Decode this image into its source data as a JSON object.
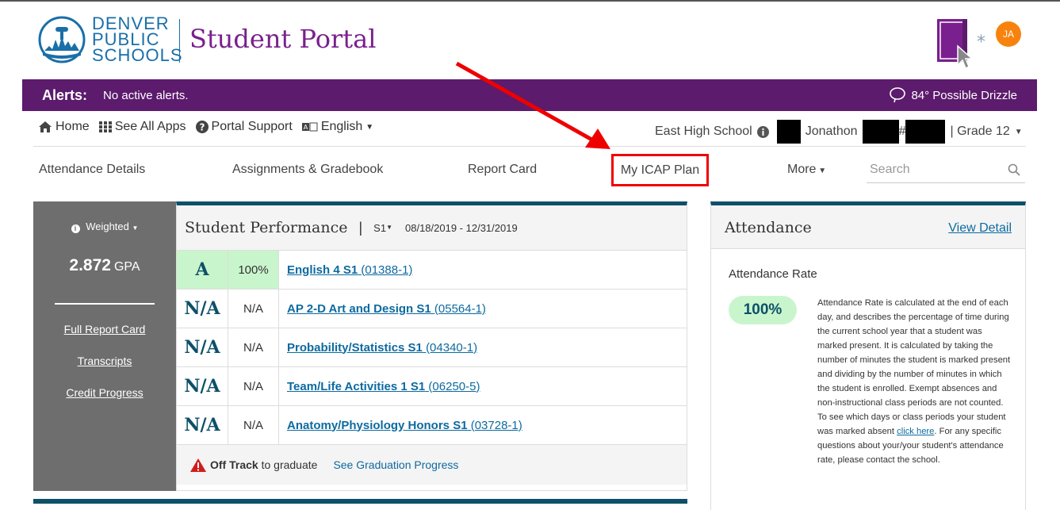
{
  "header": {
    "logo_lines": [
      "DENVER",
      "PUBLIC",
      "SCHOOLS"
    ],
    "portal_title": "Student Portal",
    "avatar_initials": "JA"
  },
  "alerts": {
    "label": "Alerts:",
    "message": "No active alerts.",
    "weather": "84° Possible Drizzle"
  },
  "util_nav": {
    "home": "Home",
    "apps": "See All Apps",
    "support": "Portal Support",
    "language": "English"
  },
  "student": {
    "school": "East High School",
    "name_part": "Jonathon",
    "id_prefix": "#",
    "grade": "| Grade 12"
  },
  "main_nav": {
    "attendance": "Attendance Details",
    "assignments": "Assignments & Gradebook",
    "report_card": "Report Card",
    "icap": "My ICAP Plan",
    "more": "More",
    "search_placeholder": "Search"
  },
  "gpa": {
    "mode": "Weighted",
    "value": "2.872",
    "unit": "GPA",
    "links": [
      "Full Report Card",
      "Transcripts",
      "Credit Progress"
    ]
  },
  "performance": {
    "title": "Student Performance",
    "separator": "|",
    "semester": "S1",
    "dates": "08/18/2019 - 12/31/2019",
    "courses": [
      {
        "grade": "A",
        "pct": "100%",
        "name": "English 4 S1",
        "code": "(01388-1)"
      },
      {
        "grade": "N/A",
        "pct": "N/A",
        "name": "AP 2-D Art and Design S1",
        "code": "(05564-1)"
      },
      {
        "grade": "N/A",
        "pct": "N/A",
        "name": "Probability/Statistics S1",
        "code": "(04340-1)"
      },
      {
        "grade": "N/A",
        "pct": "N/A",
        "name": "Team/Life Activities 1 S1",
        "code": "(06250-5)"
      },
      {
        "grade": "N/A",
        "pct": "N/A",
        "name": "Anatomy/Physiology Honors S1",
        "code": "(03728-1)"
      }
    ],
    "status_bold": "Off Track",
    "status_rest": "to graduate",
    "grad_link": "See Graduation Progress"
  },
  "attendance": {
    "title": "Attendance",
    "view_detail": "View Detail",
    "rate_label": "Attendance Rate",
    "rate": "100%",
    "desc_1": "Attendance Rate is calculated at the end of each day, and describes the percentage of time during the current school year that a student was marked present. It is calculated by taking the number of minutes the student is marked present and dividing by the number of minutes in which the student is enrolled. Exempt absences and non-instructional class periods are not counted. To see which days or class periods your student was marked absent ",
    "desc_link": "click here",
    "desc_2": ". For any specific questions about your/your student's attendance rate, please contact the school."
  },
  "colors": {
    "brand_purple": "#7a1f8e",
    "alert_bar": "#5c1b6c",
    "teal": "#0d5068",
    "link": "#0d6aa0",
    "highlight_green": "#c9f5cd",
    "annotation_red": "#e00000"
  }
}
